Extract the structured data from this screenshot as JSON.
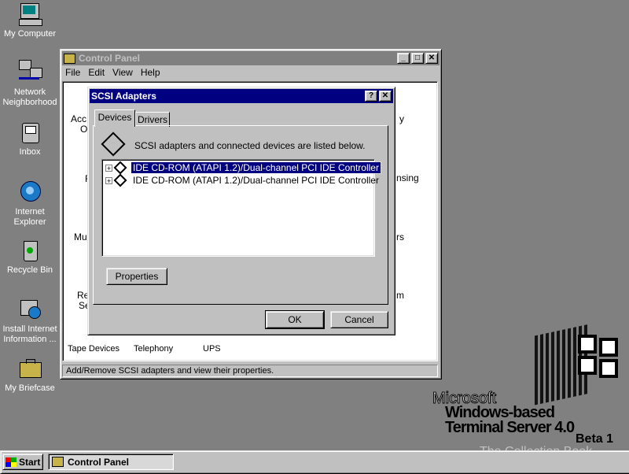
{
  "desktop": {
    "icons": [
      {
        "label": "My Computer",
        "icon": "computer-icon"
      },
      {
        "label": "Network Neighborhood",
        "icon": "network-icon"
      },
      {
        "label": "Inbox",
        "icon": "inbox-icon"
      },
      {
        "label": "Internet Explorer",
        "icon": "ie-icon"
      },
      {
        "label": "Recycle Bin",
        "icon": "recycle-bin-icon"
      },
      {
        "label": "Install Internet Information ...",
        "icon": "install-icon"
      },
      {
        "label": "My Briefcase",
        "icon": "briefcase-icon"
      }
    ],
    "background": "#808080"
  },
  "control_panel": {
    "title": "Control Panel",
    "menu": [
      "File",
      "Edit",
      "View",
      "Help"
    ],
    "items_partial": [
      "Acc",
      "Op",
      "F",
      "Mul",
      "Re",
      "Se",
      "y",
      "nsing",
      "rs",
      "m"
    ],
    "bottom_items": [
      "Tape Devices",
      "Telephony",
      "UPS"
    ],
    "status": "Add/Remove SCSI adapters and view their properties."
  },
  "dialog": {
    "title": "SCSI Adapters",
    "help_btn": "?",
    "close_btn": "✕",
    "tabs": [
      "Devices",
      "Drivers"
    ],
    "active_tab": "Devices",
    "description": "SCSI adapters and connected devices are listed below.",
    "devices": [
      {
        "label": "IDE CD-ROM (ATAPI 1.2)/Dual-channel PCI IDE Controller",
        "selected": true
      },
      {
        "label": "IDE CD-ROM (ATAPI 1.2)/Dual-channel PCI IDE Controller",
        "selected": false
      }
    ],
    "properties_btn": "Properties",
    "ok_btn": "OK",
    "cancel_btn": "Cancel"
  },
  "branding": {
    "line1": "Microsoft",
    "line2": "Windows-based",
    "line3": "Terminal Server 4.0",
    "line4": "Beta 1",
    "watermark": "The Collection Book"
  },
  "taskbar": {
    "start": "Start",
    "task": "Control Panel"
  },
  "colors": {
    "title_active": "#000080",
    "face": "#c0c0c0",
    "selection": "#000080"
  }
}
